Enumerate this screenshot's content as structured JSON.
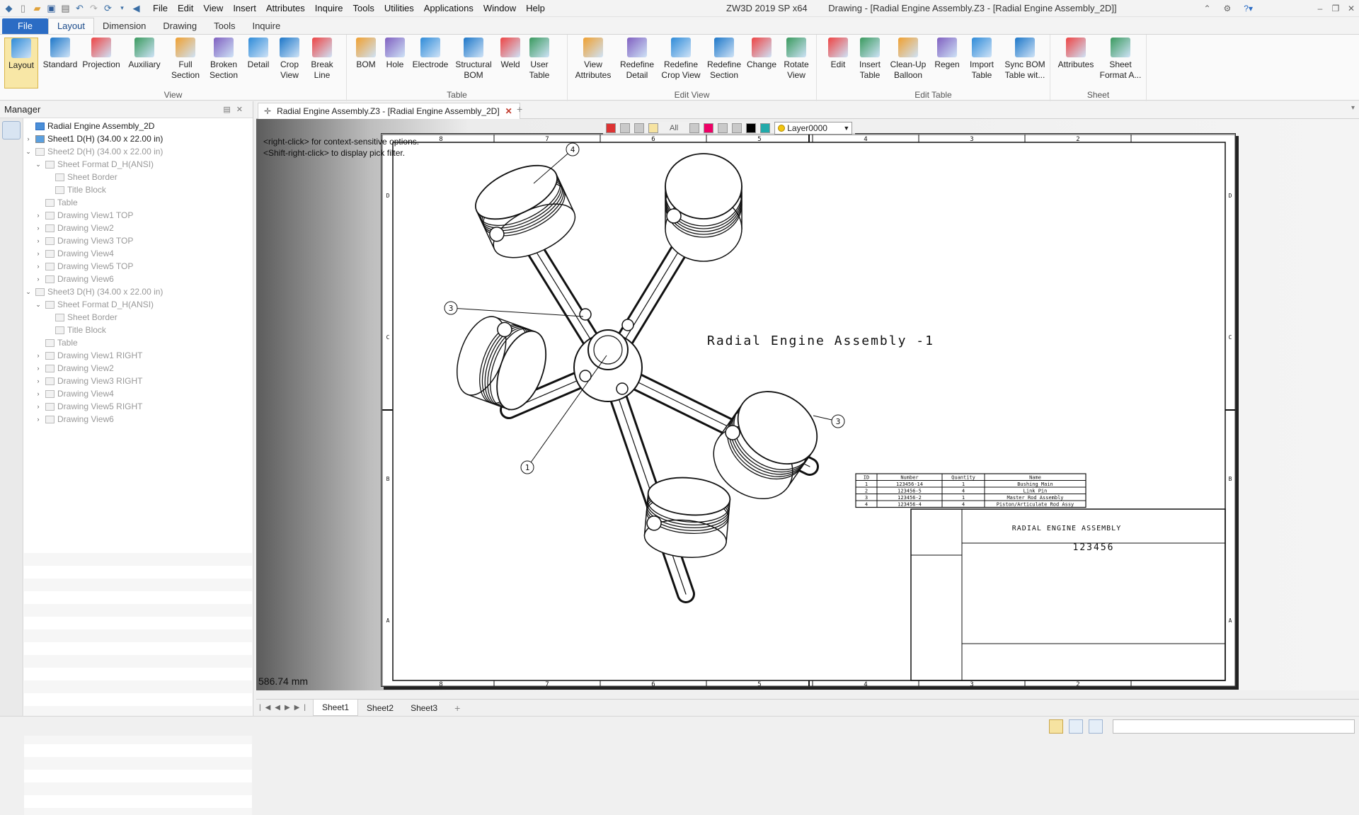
{
  "titlebar": {
    "menus": [
      "File",
      "Edit",
      "View",
      "Insert",
      "Attributes",
      "Inquire",
      "Tools",
      "Utilities",
      "Applications",
      "Window",
      "Help"
    ],
    "app_title": "ZW3D 2019 SP x64",
    "doc_title": "Drawing - [Radial Engine Assembly.Z3 - [Radial Engine Assembly_2D]]"
  },
  "ribbon_tabs": [
    "File",
    "Layout",
    "Dimension",
    "Drawing",
    "Tools",
    "Inquire"
  ],
  "ribbon_groups": {
    "view": {
      "label": "View",
      "buttons": [
        "Layout",
        "Standard",
        "Projection",
        "Auxiliary",
        "Full\nSection",
        "Broken\nSection",
        "Detail",
        "Crop\nView",
        "Break\nLine"
      ]
    },
    "table": {
      "label": "Table",
      "buttons": [
        "BOM",
        "Hole",
        "Electrode",
        "Structural\nBOM",
        "Weld",
        "User\nTable"
      ]
    },
    "edit_view": {
      "label": "Edit View",
      "buttons": [
        "View\nAttributes",
        "Redefine\nDetail",
        "Redefine\nCrop View",
        "Redefine\nSection",
        "Change",
        "Rotate\nView"
      ]
    },
    "edit_table": {
      "label": "Edit Table",
      "buttons": [
        "Edit",
        "Insert\nTable",
        "Clean-Up\nBalloon",
        "Regen",
        "Import\nTable",
        "Sync BOM\nTable wit..."
      ]
    },
    "sheet": {
      "label": "Sheet",
      "buttons": [
        "Attributes",
        "Sheet\nFormat A..."
      ]
    }
  },
  "manager": {
    "title": "Manager",
    "tree": [
      {
        "label": "Radial Engine Assembly_2D",
        "level": 0,
        "toggle": "",
        "dim": false
      },
      {
        "label": "Sheet1 D(H) (34.00 x 22.00 in)",
        "level": 0,
        "toggle": "›",
        "dim": false
      },
      {
        "label": "Sheet2 D(H) (34.00 x 22.00 in)",
        "level": 0,
        "toggle": "⌄",
        "dim": true
      },
      {
        "label": "Sheet Format D_H(ANSI)",
        "level": 1,
        "toggle": "⌄",
        "dim": true
      },
      {
        "label": "Sheet Border",
        "level": 2,
        "toggle": "",
        "dim": true
      },
      {
        "label": "Title Block",
        "level": 2,
        "toggle": "",
        "dim": true
      },
      {
        "label": "Table",
        "level": 1,
        "toggle": "",
        "dim": true
      },
      {
        "label": "Drawing View1 TOP",
        "level": 1,
        "toggle": "›",
        "dim": true
      },
      {
        "label": "Drawing View2",
        "level": 1,
        "toggle": "›",
        "dim": true
      },
      {
        "label": "Drawing View3 TOP",
        "level": 1,
        "toggle": "›",
        "dim": true
      },
      {
        "label": "Drawing View4",
        "level": 1,
        "toggle": "›",
        "dim": true
      },
      {
        "label": "Drawing View5 TOP",
        "level": 1,
        "toggle": "›",
        "dim": true
      },
      {
        "label": "Drawing View6",
        "level": 1,
        "toggle": "›",
        "dim": true
      },
      {
        "label": "Sheet3 D(H) (34.00 x 22.00 in)",
        "level": 0,
        "toggle": "⌄",
        "dim": true
      },
      {
        "label": "Sheet Format D_H(ANSI)",
        "level": 1,
        "toggle": "⌄",
        "dim": true
      },
      {
        "label": "Sheet Border",
        "level": 2,
        "toggle": "",
        "dim": true
      },
      {
        "label": "Title Block",
        "level": 2,
        "toggle": "",
        "dim": true
      },
      {
        "label": "Table",
        "level": 1,
        "toggle": "",
        "dim": true
      },
      {
        "label": "Drawing View1 RIGHT",
        "level": 1,
        "toggle": "›",
        "dim": true
      },
      {
        "label": "Drawing View2",
        "level": 1,
        "toggle": "›",
        "dim": true
      },
      {
        "label": "Drawing View3 RIGHT",
        "level": 1,
        "toggle": "›",
        "dim": true
      },
      {
        "label": "Drawing View4",
        "level": 1,
        "toggle": "›",
        "dim": true
      },
      {
        "label": "Drawing View5 RIGHT",
        "level": 1,
        "toggle": "›",
        "dim": true
      },
      {
        "label": "Drawing View6",
        "level": 1,
        "toggle": "›",
        "dim": true
      }
    ]
  },
  "doc_tab": {
    "label": "Radial Engine Assembly.Z3 - [Radial Engine Assembly_2D]"
  },
  "canvas": {
    "hint_line1": "<right-click> for context-sensitive options.",
    "hint_line2": "<Shift-right-click> to display pick filter.",
    "filter_all": "All",
    "layer": "Layer0000",
    "coord_readout": "586.74 mm"
  },
  "drawing": {
    "title": "Radial Engine Assembly -1",
    "col_numbers": [
      "8",
      "7",
      "6",
      "5",
      "4",
      "3",
      "2"
    ],
    "row_letters": [
      "D",
      "C",
      "B",
      "A"
    ],
    "balloons": [
      "4",
      "3",
      "1",
      "3"
    ],
    "bom_headers": [
      "ID",
      "Number",
      "Quantity",
      "Name"
    ],
    "bom_rows": [
      [
        "1",
        "123456-14",
        "1",
        "Bushing Main"
      ],
      [
        "2",
        "123456-5",
        "4",
        "Link Pin"
      ],
      [
        "3",
        "123456-2",
        "1",
        "Master Rod Assembly"
      ],
      [
        "4",
        "123456-4",
        "4",
        "Piston/Articulate Rod Assy"
      ]
    ],
    "title_block_name": "RADIAL ENGINE ASSEMBLY",
    "title_block_number": "123456"
  },
  "sheet_tabs": [
    "Sheet1",
    "Sheet2",
    "Sheet3"
  ],
  "colors": {
    "file_tab": "#2b6cc4",
    "active_button": "#f8e7a6"
  }
}
